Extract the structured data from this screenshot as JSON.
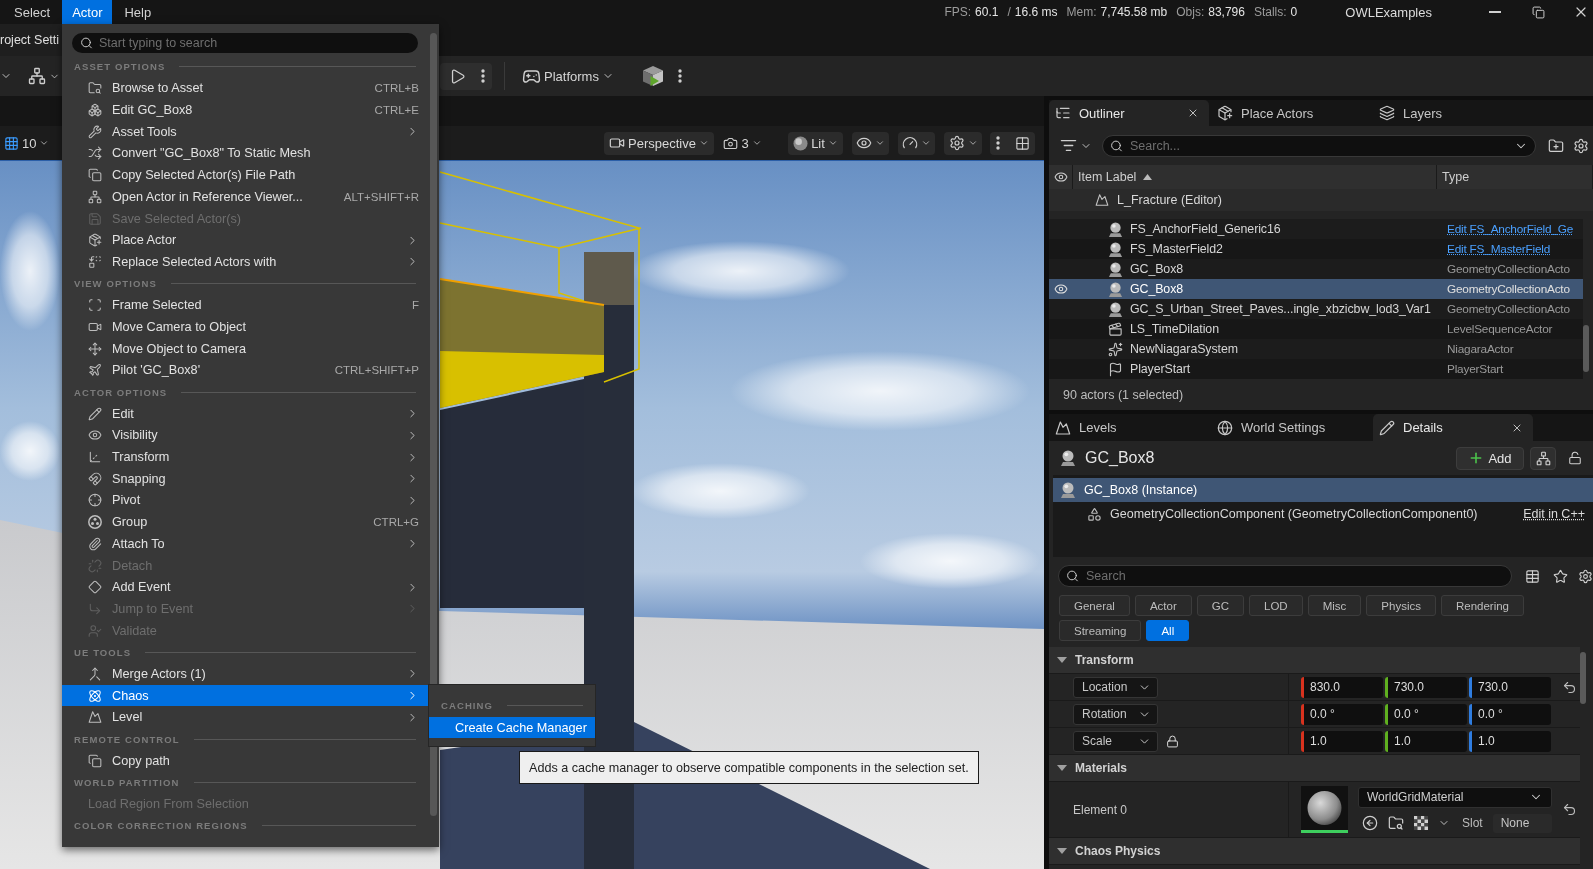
{
  "menu_bar": {
    "items": [
      {
        "label": "Select",
        "selected": false
      },
      {
        "label": "Actor",
        "selected": true
      },
      {
        "label": "Help",
        "selected": false
      }
    ],
    "stats": [
      {
        "label": "FPS:",
        "value": "60.1"
      },
      {
        "label": "/",
        "value": "16.6 ms"
      },
      {
        "label": "Mem:",
        "value": "7,745.58 mb"
      },
      {
        "label": "Objs:",
        "value": "83,796"
      },
      {
        "label": "Stalls:",
        "value": "0"
      }
    ],
    "project": "OWLExamples"
  },
  "document_tabs": [
    {
      "label": "roject Setti"
    }
  ],
  "main_toolbar": {
    "platforms": "Platforms"
  },
  "viewport_toolbar": {
    "grid_snap": "10",
    "view_mode": "Perspective",
    "camera_speed": "3",
    "lighting": "Lit"
  },
  "actor_menu": {
    "search_placeholder": "Start typing to search",
    "sections": [
      {
        "title": "ASSET OPTIONS",
        "items": [
          {
            "label": "Browse to Asset",
            "shortcut": "CTRL+B",
            "submenu": false,
            "disabled": false,
            "selected": false
          },
          {
            "label": "Edit GC_Box8",
            "shortcut": "CTRL+E",
            "submenu": false,
            "disabled": false,
            "selected": false
          },
          {
            "label": "Asset Tools",
            "submenu": true,
            "disabled": false,
            "selected": false
          },
          {
            "label": "Convert \"GC_Box8\" To Static Mesh",
            "submenu": false,
            "disabled": false,
            "selected": false
          },
          {
            "label": "Copy Selected Actor(s) File Path",
            "submenu": false,
            "disabled": false,
            "selected": false
          },
          {
            "label": "Open Actor in Reference Viewer...",
            "shortcut": "ALT+SHIFT+R",
            "submenu": false,
            "disabled": false,
            "selected": false
          },
          {
            "label": "Save Selected Actor(s)",
            "submenu": false,
            "disabled": true,
            "selected": false
          },
          {
            "label": "Place Actor",
            "submenu": true,
            "disabled": false,
            "selected": false
          },
          {
            "label": "Replace Selected Actors with",
            "submenu": true,
            "disabled": false,
            "selected": false
          }
        ]
      },
      {
        "title": "VIEW OPTIONS",
        "items": [
          {
            "label": "Frame Selected",
            "shortcut": "F",
            "submenu": false,
            "disabled": false,
            "selected": false
          },
          {
            "label": "Move Camera to Object",
            "submenu": false,
            "disabled": false,
            "selected": false
          },
          {
            "label": "Move Object to Camera",
            "submenu": false,
            "disabled": false,
            "selected": false
          },
          {
            "label": "Pilot 'GC_Box8'",
            "shortcut": "CTRL+SHIFT+P",
            "submenu": false,
            "disabled": false,
            "selected": false
          }
        ]
      },
      {
        "title": "ACTOR OPTIONS",
        "items": [
          {
            "label": "Edit",
            "submenu": true,
            "disabled": false,
            "selected": false
          },
          {
            "label": "Visibility",
            "submenu": true,
            "disabled": false,
            "selected": false
          },
          {
            "label": "Transform",
            "submenu": true,
            "disabled": false,
            "selected": false
          },
          {
            "label": "Snapping",
            "submenu": true,
            "disabled": false,
            "selected": false
          },
          {
            "label": "Pivot",
            "submenu": true,
            "disabled": false,
            "selected": false
          },
          {
            "label": "Group",
            "shortcut": "CTRL+G",
            "submenu": false,
            "disabled": false,
            "selected": false
          },
          {
            "label": "Attach To",
            "submenu": true,
            "disabled": false,
            "selected": false
          },
          {
            "label": "Detach",
            "submenu": false,
            "disabled": true,
            "selected": false
          },
          {
            "label": "Add Event",
            "submenu": true,
            "disabled": false,
            "selected": false
          },
          {
            "label": "Jump to Event",
            "submenu": true,
            "disabled": true,
            "selected": false
          },
          {
            "label": "Validate",
            "submenu": false,
            "disabled": true,
            "selected": false
          }
        ]
      },
      {
        "title": "UE TOOLS",
        "items": [
          {
            "label": "Merge Actors (1)",
            "submenu": true,
            "disabled": false,
            "selected": false
          },
          {
            "label": "Chaos",
            "submenu": true,
            "disabled": false,
            "selected": true
          },
          {
            "label": "Level",
            "submenu": true,
            "disabled": false,
            "selected": false
          }
        ]
      },
      {
        "title": "REMOTE CONTROL",
        "items": [
          {
            "label": "Copy path",
            "submenu": false,
            "disabled": false,
            "selected": false
          }
        ]
      },
      {
        "title": "WORLD PARTITION",
        "items": [
          {
            "label": "Load Region From Selection",
            "submenu": false,
            "disabled": true,
            "selected": false
          }
        ]
      },
      {
        "title": "COLOR CORRECTION REGIONS"
      }
    ]
  },
  "chaos_submenu": {
    "sections": [
      {
        "title": "CACHING",
        "items": [
          {
            "label": "Create Cache Manager",
            "submenu": false,
            "disabled": false,
            "selected": true
          }
        ]
      }
    ]
  },
  "tooltip": {
    "text": "Adds a cache manager to observe compatible components in the selection set."
  },
  "outliner": {
    "tabs": [
      {
        "label": "Outliner",
        "selected": true,
        "closable": true
      },
      {
        "label": "Place Actors",
        "selected": false,
        "closable": false
      },
      {
        "label": "Layers",
        "selected": false,
        "closable": false
      }
    ],
    "search_placeholder": "Search...",
    "columns": [
      "Item Label",
      "Type"
    ],
    "level": "L_Fracture (Editor)",
    "rows": [
      {
        "kind": "field",
        "label": "FS_AnchorField_Generic16",
        "type": "Edit FS_AnchorField_Ge",
        "selected": false
      },
      {
        "kind": "field",
        "label": "FS_MasterField2",
        "type": "Edit FS_MasterField",
        "selected": false
      },
      {
        "kind": "geometry",
        "label": "GC_Box8",
        "type": "GeometryCollectionActo",
        "selected": false
      },
      {
        "kind": "geometry",
        "label": "GC_Box8",
        "type": "GeometryCollectionActo",
        "selected": true
      },
      {
        "kind": "geometry",
        "label": "GC_S_Urban_Street_Paves...ingle_xbzicbw_lod3_Var1",
        "type": "GeometryCollectionActo",
        "selected": false
      },
      {
        "kind": "sequence",
        "label": "LS_TimeDilation",
        "type": "LevelSequenceActor",
        "selected": false
      },
      {
        "kind": "niagara",
        "label": "NewNiagaraSystem",
        "type": "NiagaraActor",
        "selected": false
      },
      {
        "kind": "start",
        "label": "PlayerStart",
        "type": "PlayerStart",
        "selected": false
      }
    ],
    "footer": "90 actors (1 selected)"
  },
  "details": {
    "tabs": [
      {
        "label": "Levels",
        "selected": false,
        "closable": false
      },
      {
        "label": "World Settings",
        "selected": false,
        "closable": false
      },
      {
        "label": "Details",
        "selected": true,
        "closable": true
      }
    ],
    "actor": "GC_Box8",
    "add_button": "Add",
    "components": [
      {
        "label": "GC_Box8 (Instance)",
        "selected": true,
        "children": [
          {
            "label": "GeometryCollectionComponent (GeometryCollectionComponent0)",
            "selected": false,
            "link": "Edit in C++"
          }
        ]
      }
    ],
    "search_placeholder": "Search",
    "filters": [
      {
        "label": "General",
        "selected": false
      },
      {
        "label": "Actor",
        "selected": false
      },
      {
        "label": "GC",
        "selected": false
      },
      {
        "label": "LOD",
        "selected": false
      },
      {
        "label": "Misc",
        "selected": false
      },
      {
        "label": "Physics",
        "selected": false
      },
      {
        "label": "Rendering",
        "selected": false
      },
      {
        "label": "Streaming",
        "selected": false
      },
      {
        "label": "All",
        "selected": true
      }
    ],
    "categories": [
      {
        "title": "Transform",
        "expanded": true,
        "rows": [
          {
            "kind": "vector",
            "label": "Location",
            "values": [
              "830.0",
              "730.0",
              "730.0"
            ],
            "ratio_lock": false,
            "reset": true
          },
          {
            "kind": "vector",
            "label": "Rotation",
            "values": [
              "0.0 °",
              "0.0 °",
              "0.0 °"
            ],
            "ratio_lock": false,
            "reset": false
          },
          {
            "kind": "vector",
            "label": "Scale",
            "values": [
              "1.0",
              "1.0",
              "1.0"
            ],
            "ratio_lock": true,
            "reset": false
          }
        ]
      },
      {
        "title": "Materials",
        "expanded": true,
        "rows": [
          {
            "kind": "material",
            "label": "Element 0",
            "material": "WorldGridMaterial",
            "slot_label": "Slot",
            "slot_value": "None",
            "reset": true
          }
        ]
      },
      {
        "title": "Chaos Physics",
        "expanded": true
      }
    ]
  }
}
